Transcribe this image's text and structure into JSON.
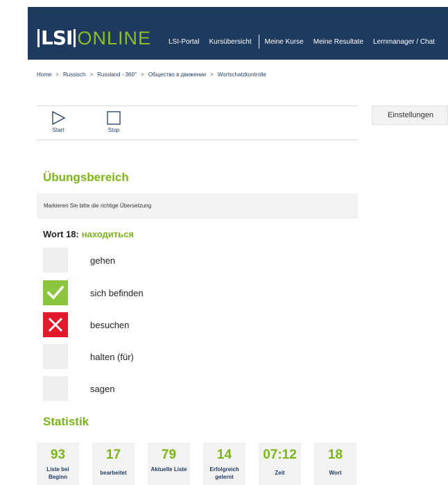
{
  "header": {
    "logo_mark": "LSI",
    "logo_text": "ONLINE",
    "nav": [
      "LSI-Portal",
      "Kursübersicht",
      "Meine Kurse",
      "Meine Resultate",
      "Lernmanager / Chat"
    ]
  },
  "breadcrumb": [
    "Home",
    "Russisch",
    "Russland - 360°",
    "Общество в движении",
    "Wortschatzkontrolle"
  ],
  "breadcrumb_sep": ">",
  "toolbar": {
    "start_label": "Start",
    "stop_label": "Stop"
  },
  "settings_label": "Einstellungen",
  "exercise": {
    "title": "Übungsbereich",
    "instruction": "Markieren Sie bitte die richtige Übersetzung",
    "word_prefix": "Wort 18:",
    "word": "находиться",
    "options": [
      {
        "label": "gehen",
        "state": "neutral"
      },
      {
        "label": "sich befinden",
        "state": "correct"
      },
      {
        "label": "besuchen",
        "state": "wrong"
      },
      {
        "label": "halten (für)",
        "state": "neutral"
      },
      {
        "label": "sagen",
        "state": "neutral"
      }
    ]
  },
  "statistics": {
    "title": "Statistik",
    "items": [
      {
        "value": "93",
        "label": "Liste bei Beginn"
      },
      {
        "value": "17",
        "label": "bearbeitet"
      },
      {
        "value": "79",
        "label": "Aktuelle Liste"
      },
      {
        "value": "14",
        "label": "Erfolgreich gelernt"
      },
      {
        "value": "07:12",
        "label": "Zeit"
      },
      {
        "value": "18",
        "label": "Wort"
      }
    ]
  },
  "colors": {
    "header_bg": "#1f3a5f",
    "accent_green": "#7cb518",
    "correct": "#8cc63f",
    "wrong": "#e01a2c"
  }
}
